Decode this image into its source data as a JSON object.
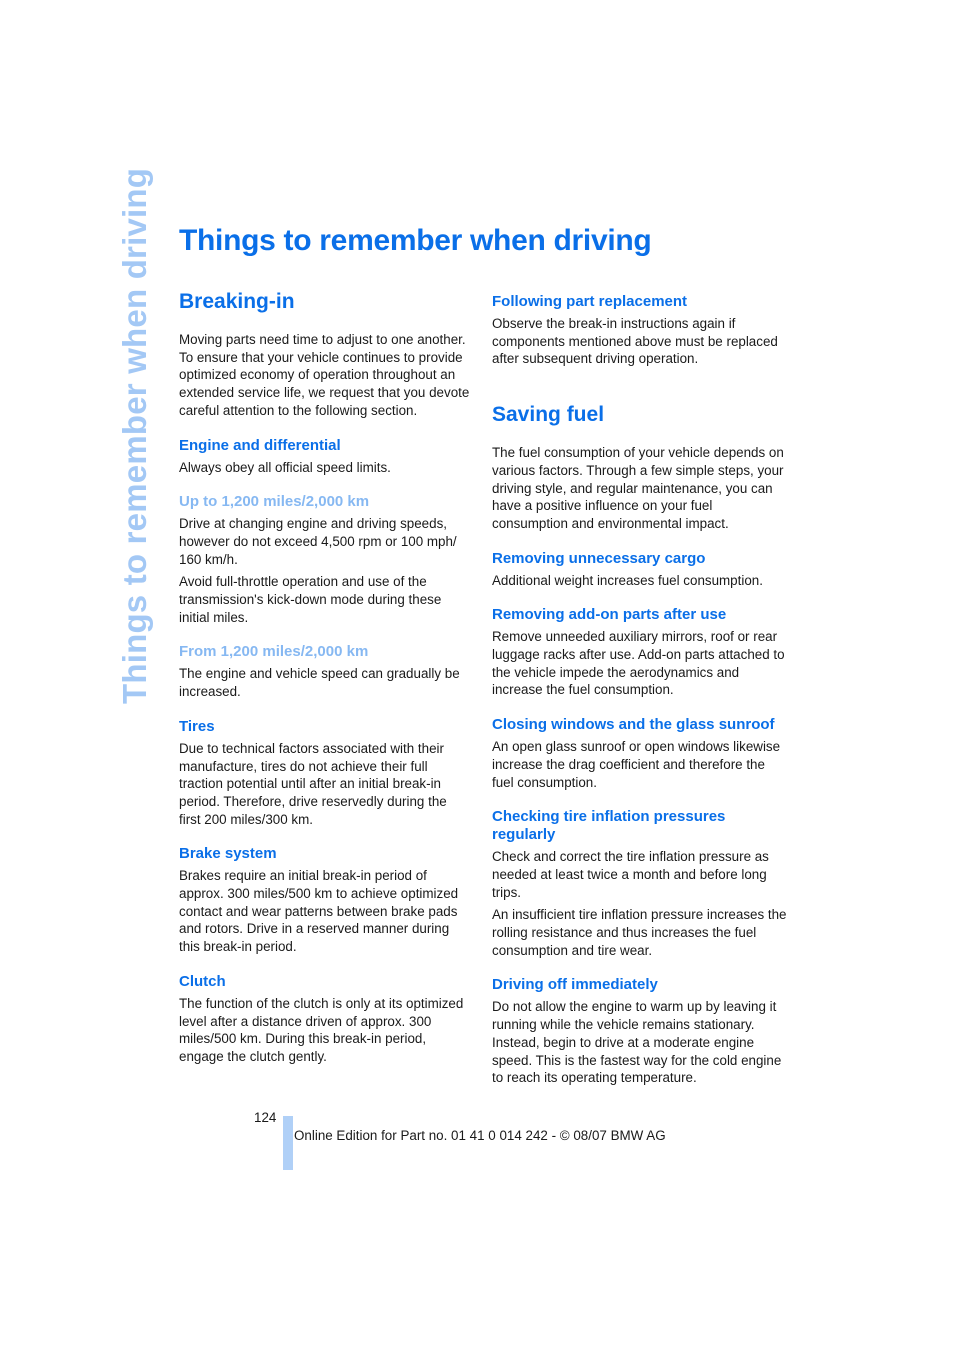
{
  "side_tab": "Things to remember when driving",
  "title": "Things to remember when driving",
  "left_column": {
    "breaking_in": {
      "heading": "Breaking-in",
      "intro": "Moving parts need time to adjust to one another. To ensure that your vehicle continues to provide optimized economy of operation throughout an extended service life, we request that you devote careful attention to the following section."
    },
    "engine": {
      "heading": "Engine and differential",
      "text": "Always obey all official speed limits."
    },
    "up_to": {
      "heading": "Up to 1,200 miles/2,000 km",
      "paragraphs": [
        "Drive at changing engine and driving speeds, however do not exceed 4,500 rpm or 100 mph/ 160 km/h.",
        "Avoid full-throttle operation and use of the transmission's kick-down mode during these initial miles."
      ]
    },
    "from": {
      "heading": "From 1,200 miles/2,000 km",
      "text": "The engine and vehicle speed can gradually be increased."
    },
    "tires": {
      "heading": "Tires",
      "text": "Due to technical factors associated with their manufacture, tires do not achieve their full traction potential until after an initial break-in period. Therefore, drive reservedly during the first 200 miles/300 km."
    },
    "brakes": {
      "heading": "Brake system",
      "text": "Brakes require an initial break-in period of approx. 300 miles/500 km to achieve optimized contact and wear patterns between brake pads and rotors. Drive in a reserved manner during this break-in period."
    },
    "clutch": {
      "heading": "Clutch",
      "text": "The function of the clutch is only at its optimized level after a distance driven of approx. 300 miles/500 km. During this break-in period, engage the clutch gently."
    }
  },
  "right_column": {
    "following": {
      "heading": "Following part replacement",
      "text": "Observe the break-in instructions again if components mentioned above must be replaced after subsequent driving operation."
    },
    "saving_fuel": {
      "heading": "Saving fuel",
      "intro": "The fuel consumption of your vehicle depends on various factors. Through a few simple steps, your driving style, and regular maintenance, you can have a positive influence on your fuel consumption and environmental impact."
    },
    "cargo": {
      "heading": "Removing unnecessary cargo",
      "text": "Additional weight increases fuel consumption."
    },
    "addon": {
      "heading": "Removing add-on parts after use",
      "text": "Remove unneeded auxiliary mirrors, roof or rear luggage racks after use. Add-on parts attached to the vehicle impede the aerodynamics and increase the fuel consumption."
    },
    "windows": {
      "heading": "Closing windows and the glass sunroof",
      "text": "An open glass sunroof or open windows likewise increase the drag coefficient and therefore the fuel consumption."
    },
    "tire_pressure": {
      "heading": "Checking tire inflation pressures regularly",
      "paragraphs": [
        "Check and correct the tire inflation pressure as needed at least twice a month and before long trips.",
        "An insufficient tire inflation pressure increases the rolling resistance and thus increases the fuel consumption and tire wear."
      ]
    },
    "driving_off": {
      "heading": "Driving off immediately",
      "text": "Do not allow the engine to warm up by leaving it running while the vehicle remains stationary. Instead, begin to drive at a moderate engine speed. This is the fastest way for the cold engine to reach its operating temperature."
    }
  },
  "footer": {
    "page_number": "124",
    "edition": "Online Edition for Part no. 01 41 0 014 242 - © 08/07 BMW AG"
  },
  "colors": {
    "heading_blue": "#0a6fe8",
    "light_blue": "#86b8f2",
    "side_tab": "#a3c8f5",
    "footer_bar": "#b0d0f7"
  }
}
